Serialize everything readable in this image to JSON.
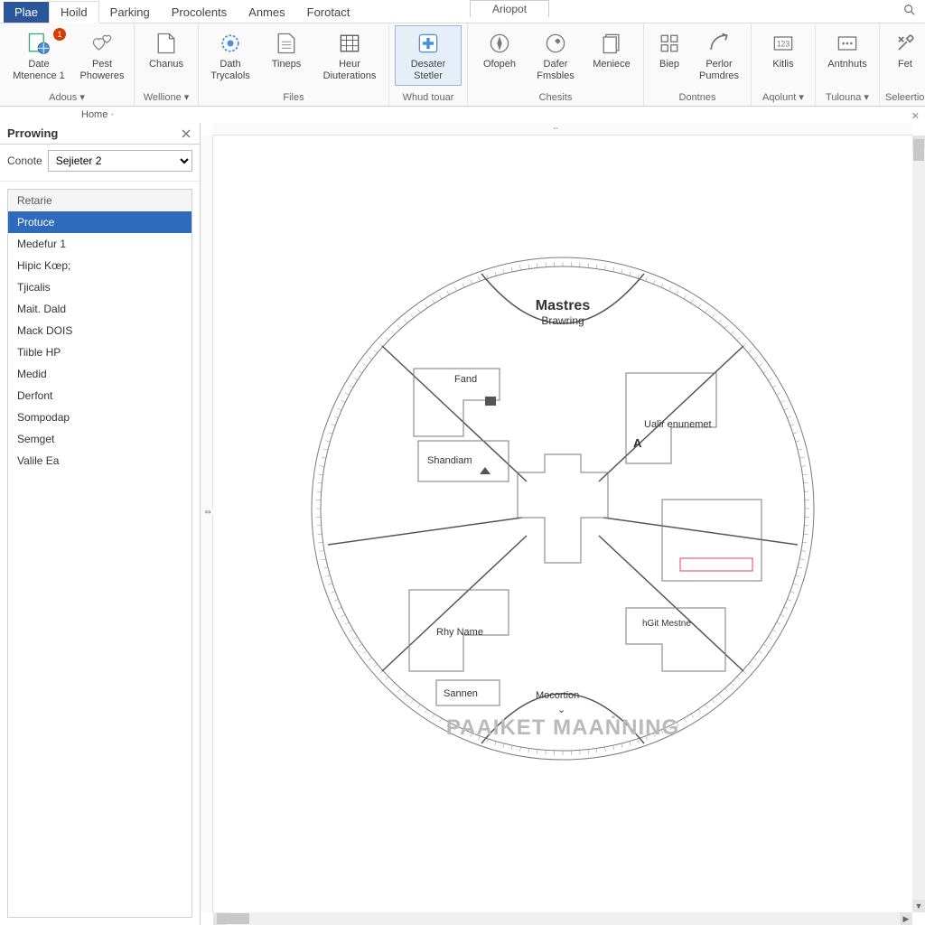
{
  "tabs": {
    "primary": "Plae",
    "items": [
      "Hoild",
      "Parking",
      "Procolents",
      "Anmes",
      "Forotact"
    ],
    "active_index": 0,
    "document_tab": "Ariopot"
  },
  "ribbon": {
    "groups": [
      {
        "label": "Adous ▾",
        "buttons": [
          {
            "name": "date-mtenence",
            "label": "Date Mtenence 1",
            "icon": "doc-globe",
            "badge": "1"
          },
          {
            "name": "pest-phoweres",
            "label": "Pest Phoweres",
            "icon": "hearts"
          }
        ]
      },
      {
        "label": "Wellione ▾",
        "buttons": [
          {
            "name": "chanus",
            "label": "Chanus",
            "icon": "page-fold"
          }
        ]
      },
      {
        "label": "Files",
        "buttons": [
          {
            "name": "dath-trycalols",
            "label": "Dath Trycalols",
            "icon": "gear-ring"
          },
          {
            "name": "tineps",
            "label": "Tineps",
            "icon": "page-lines"
          },
          {
            "name": "heur-diuterations",
            "label": "Heur Diuterations",
            "icon": "table-grid"
          }
        ]
      },
      {
        "label": "Whud touar",
        "buttons": [
          {
            "name": "desater-stetler",
            "label": "Desater Stetler",
            "icon": "plus-badge",
            "active": true
          }
        ]
      },
      {
        "label": "Chesits",
        "buttons": [
          {
            "name": "otopeh",
            "label": "Ofopeh",
            "icon": "compass"
          },
          {
            "name": "dafer-fmsbles",
            "label": "Dafer Fmsbles",
            "icon": "wrench-ring"
          },
          {
            "name": "meniece",
            "label": "Meniece",
            "icon": "pages-stack"
          }
        ]
      },
      {
        "label": "Dontnes",
        "buttons": [
          {
            "name": "biep",
            "label": "Biep",
            "icon": "grid-small"
          },
          {
            "name": "perlor-pumdres",
            "label": "Perlor Pumdres",
            "icon": "arrow-curve"
          }
        ]
      },
      {
        "label": "Aqolunt ▾",
        "buttons": [
          {
            "name": "kitks",
            "label": "Kitlis",
            "icon": "box-digits"
          }
        ]
      },
      {
        "label": "Tulouna ▾",
        "buttons": [
          {
            "name": "antnhuts",
            "label": "Antnhuts",
            "icon": "box-dots"
          }
        ]
      },
      {
        "label": "Seleertions",
        "buttons": [
          {
            "name": "fet",
            "label": "Fet",
            "icon": "wrench-cross"
          }
        ]
      }
    ]
  },
  "breadcrumb": {
    "items": [
      "Home ·"
    ]
  },
  "panel": {
    "title": "Prrowing",
    "filter_label": "Conote",
    "filter_value": "Sejieter 2",
    "items": [
      {
        "label": "Retarie",
        "header": true
      },
      {
        "label": "Protuce",
        "selected": true
      },
      {
        "label": "Medefur 1"
      },
      {
        "label": "Hipic Kœp;"
      },
      {
        "label": "Tjicalis"
      },
      {
        "label": "Mait. Dald"
      },
      {
        "label": "Mack DOIS"
      },
      {
        "label": "Tiible HP"
      },
      {
        "label": "Medid"
      },
      {
        "label": "Derfont"
      },
      {
        "label": "Sompodap"
      },
      {
        "label": "Semget"
      },
      {
        "label": "Valile Ea"
      }
    ]
  },
  "drawing": {
    "title": "Mastres",
    "subtitle": "Brawring",
    "watermark": "PAAIKET MAAṄNING",
    "rooms": {
      "fand": "Fand",
      "shandiam": "Shandiam",
      "ualir": "Ualir enunemet",
      "a": "A",
      "rhy": "Rhy Name",
      "sannen": "Sannen",
      "mocortion": "Mocortion",
      "hgit": "hGit Mestne"
    }
  }
}
